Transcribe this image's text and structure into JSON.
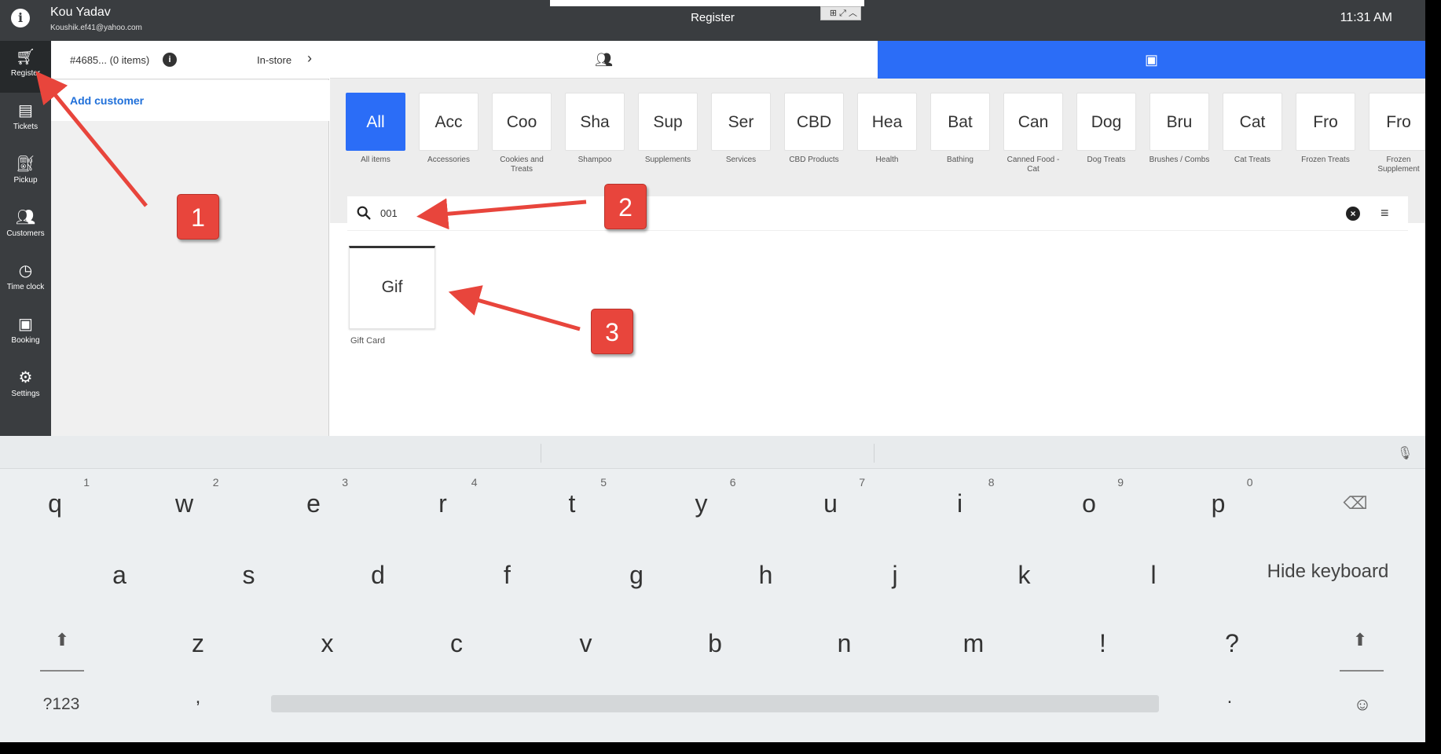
{
  "topbar": {
    "user_name": "Kou Yadav",
    "user_email": "Koushik.ef41@yahoo.com",
    "title": "Register",
    "time": "11:31 AM"
  },
  "nav": [
    {
      "label": "Register",
      "icon": "cart-icon",
      "glyph": "🛒︎",
      "active": true
    },
    {
      "label": "Tickets",
      "icon": "tickets-icon",
      "glyph": "▤"
    },
    {
      "label": "Pickup",
      "icon": "pickup-icon",
      "glyph": "⛽︎"
    },
    {
      "label": "Customers",
      "icon": "customers-icon",
      "glyph": "👥︎"
    },
    {
      "label": "Time clock",
      "icon": "clock-icon",
      "glyph": "◷"
    },
    {
      "label": "Booking",
      "icon": "calendar-icon",
      "glyph": "▣"
    },
    {
      "label": "Settings",
      "icon": "gear-icon",
      "glyph": "⚙"
    }
  ],
  "ticket": {
    "id": "#4685... (0 items)",
    "mode": "In-store",
    "add_customer": "Add customer"
  },
  "tabs": {
    "customers_icon": "customers-icon",
    "items_icon": "gallery-icon",
    "active": "items"
  },
  "categories": [
    {
      "abbr": "All",
      "label": "All items",
      "active": true
    },
    {
      "abbr": "Acc",
      "label": "Accessories"
    },
    {
      "abbr": "Coo",
      "label": "Cookies and Treats"
    },
    {
      "abbr": "Sha",
      "label": "Shampoo"
    },
    {
      "abbr": "Sup",
      "label": "Supplements"
    },
    {
      "abbr": "Ser",
      "label": "Services"
    },
    {
      "abbr": "CBD",
      "label": "CBD Products"
    },
    {
      "abbr": "Hea",
      "label": "Health"
    },
    {
      "abbr": "Bat",
      "label": "Bathing"
    },
    {
      "abbr": "Can",
      "label": "Canned Food - Cat"
    },
    {
      "abbr": "Dog",
      "label": "Dog Treats"
    },
    {
      "abbr": "Bru",
      "label": "Brushes / Combs"
    },
    {
      "abbr": "Cat",
      "label": "Cat Treats"
    },
    {
      "abbr": "Fro",
      "label": "Frozen Treats"
    },
    {
      "abbr": "Fro",
      "label": "Frozen Supplement"
    }
  ],
  "search": {
    "value": "001"
  },
  "products": [
    {
      "abbr": "Gif",
      "label": "Gift Card"
    }
  ],
  "keyboard": {
    "row1": [
      {
        "k": "q",
        "h": "1"
      },
      {
        "k": "w",
        "h": "2"
      },
      {
        "k": "e",
        "h": "3"
      },
      {
        "k": "r",
        "h": "4"
      },
      {
        "k": "t",
        "h": "5"
      },
      {
        "k": "y",
        "h": "6"
      },
      {
        "k": "u",
        "h": "7"
      },
      {
        "k": "i",
        "h": "8"
      },
      {
        "k": "o",
        "h": "9"
      },
      {
        "k": "p",
        "h": "0"
      }
    ],
    "row2": [
      "a",
      "s",
      "d",
      "f",
      "g",
      "h",
      "j",
      "k",
      "l"
    ],
    "row3": [
      "z",
      "x",
      "c",
      "v",
      "b",
      "n",
      "m",
      "!",
      "?"
    ],
    "hide": "Hide keyboard",
    "symbols": "?123",
    "comma": ",",
    "period": "."
  },
  "annotations": [
    {
      "label": "1"
    },
    {
      "label": "2"
    },
    {
      "label": "3"
    }
  ],
  "colors": {
    "accent": "#2b6df7",
    "callout": "#e8453c",
    "nav_bg": "#3a3d40"
  }
}
